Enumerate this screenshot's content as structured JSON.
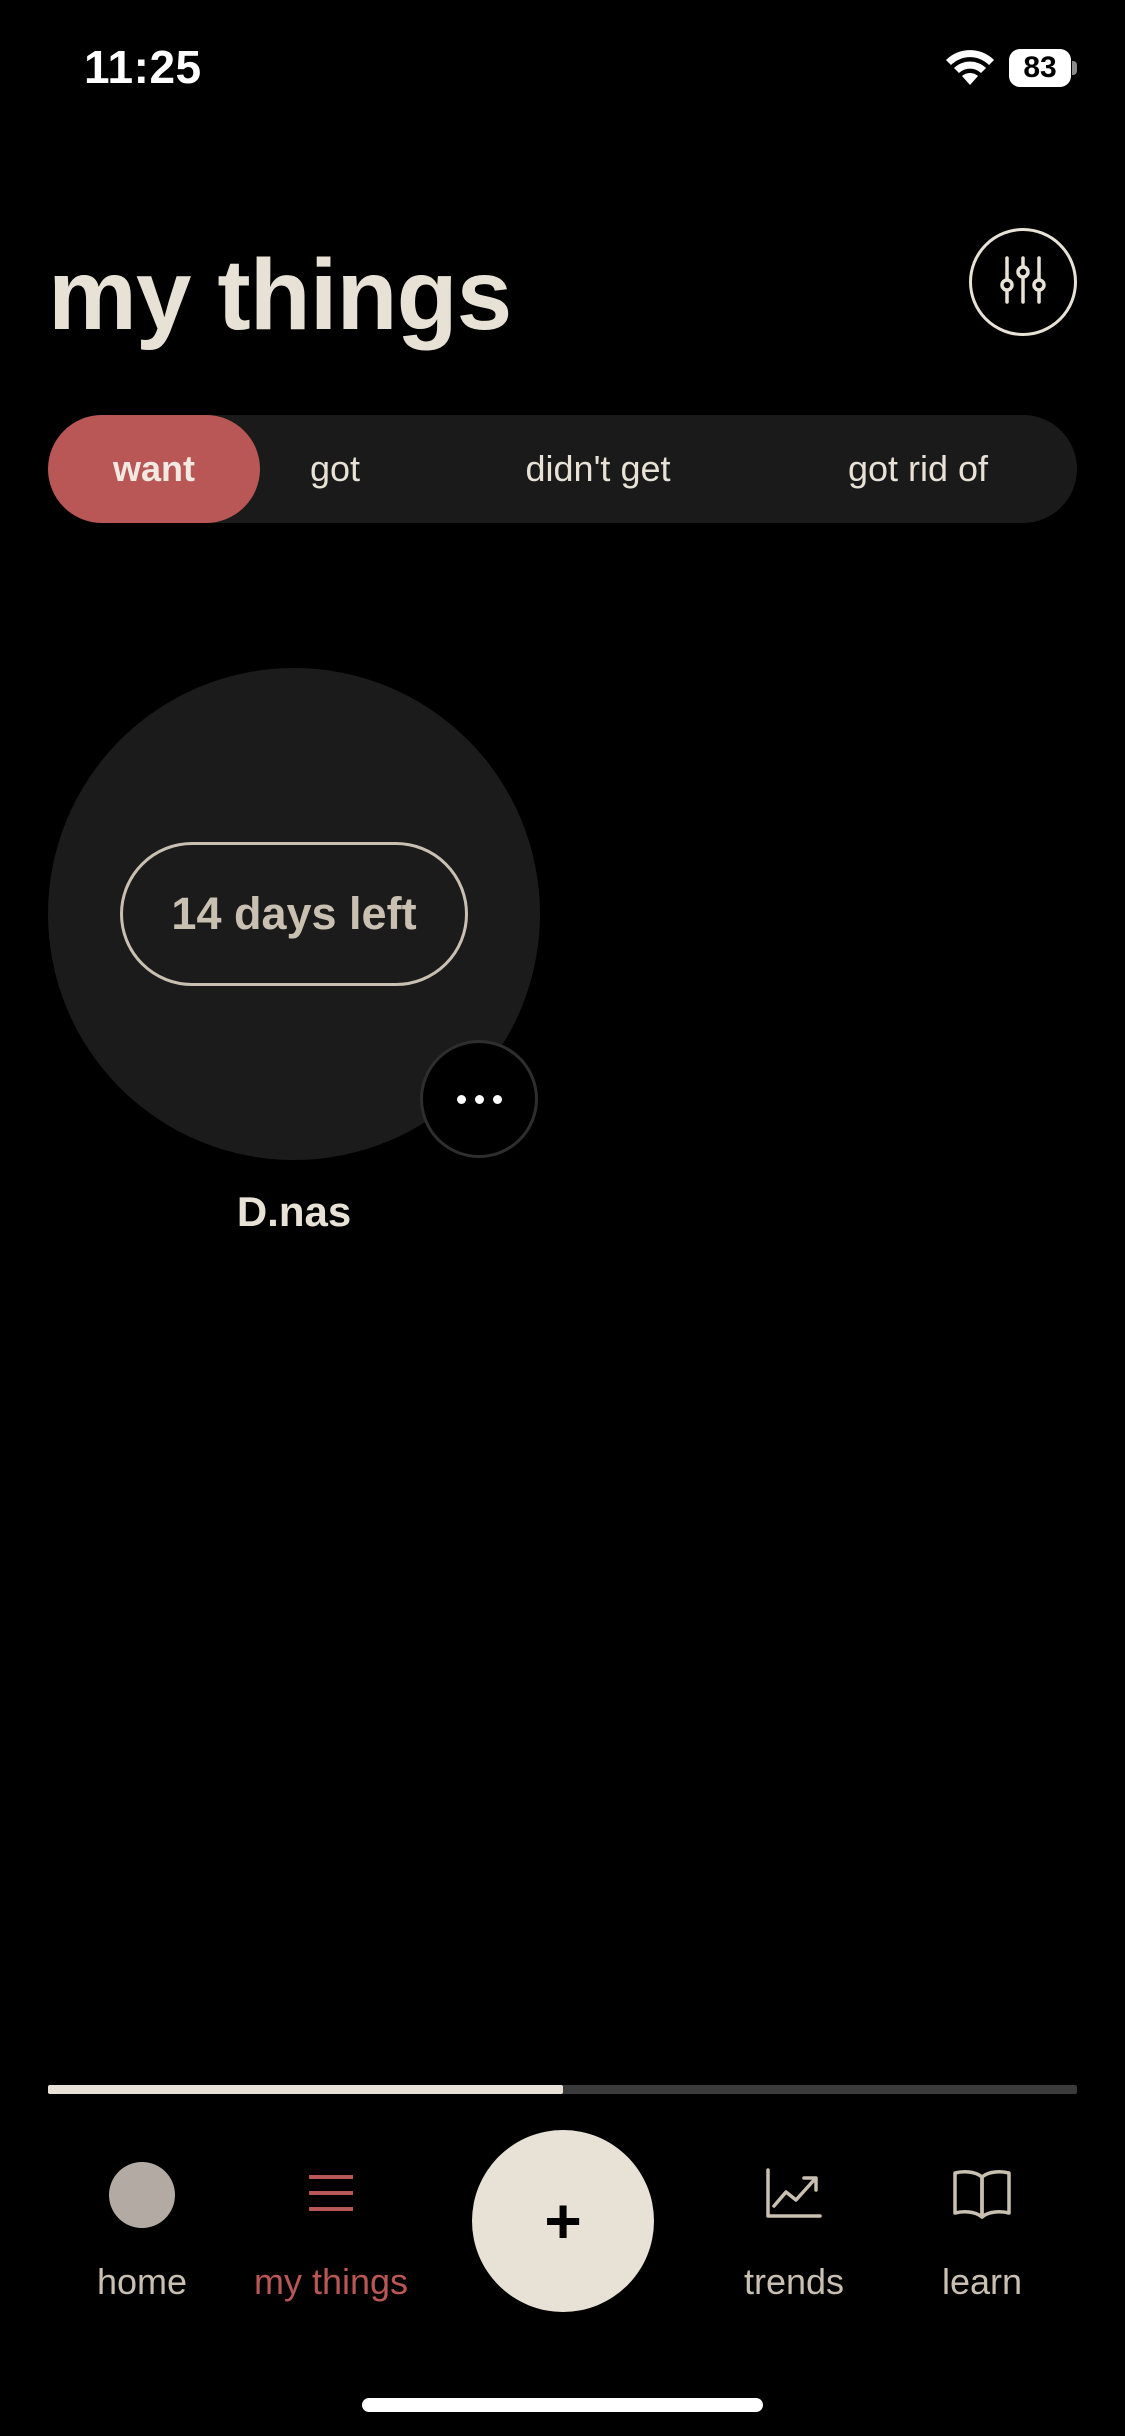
{
  "status_bar": {
    "time": "11:25",
    "battery": "83",
    "icons": [
      "wifi-icon",
      "battery-icon"
    ]
  },
  "header": {
    "title": "my things",
    "filter_icon": "sliders-icon"
  },
  "tabs": [
    {
      "label": "want",
      "selected": true
    },
    {
      "label": "got",
      "selected": false
    },
    {
      "label": "didn't get",
      "selected": false
    },
    {
      "label": "got rid of",
      "selected": false
    }
  ],
  "items": [
    {
      "name": "D.nas",
      "countdown": "14 days left",
      "more_icon": "more-dots-icon"
    }
  ],
  "progress": {
    "fraction": 0.5
  },
  "nav": {
    "home": {
      "label": "home",
      "icon": "avatar-circle-icon"
    },
    "my_things": {
      "label": "my things",
      "icon": "menu-lines-icon",
      "active": true
    },
    "add": {
      "label": "+",
      "icon": "plus-icon"
    },
    "trends": {
      "label": "trends",
      "icon": "chart-trend-icon"
    },
    "learn": {
      "label": "learn",
      "icon": "book-icon"
    }
  },
  "colors": {
    "background": "#000000",
    "accent": "#b95656",
    "text": "#e8e2d6",
    "muted_text": "#c9c0b2",
    "surface": "#1a1a1a"
  }
}
